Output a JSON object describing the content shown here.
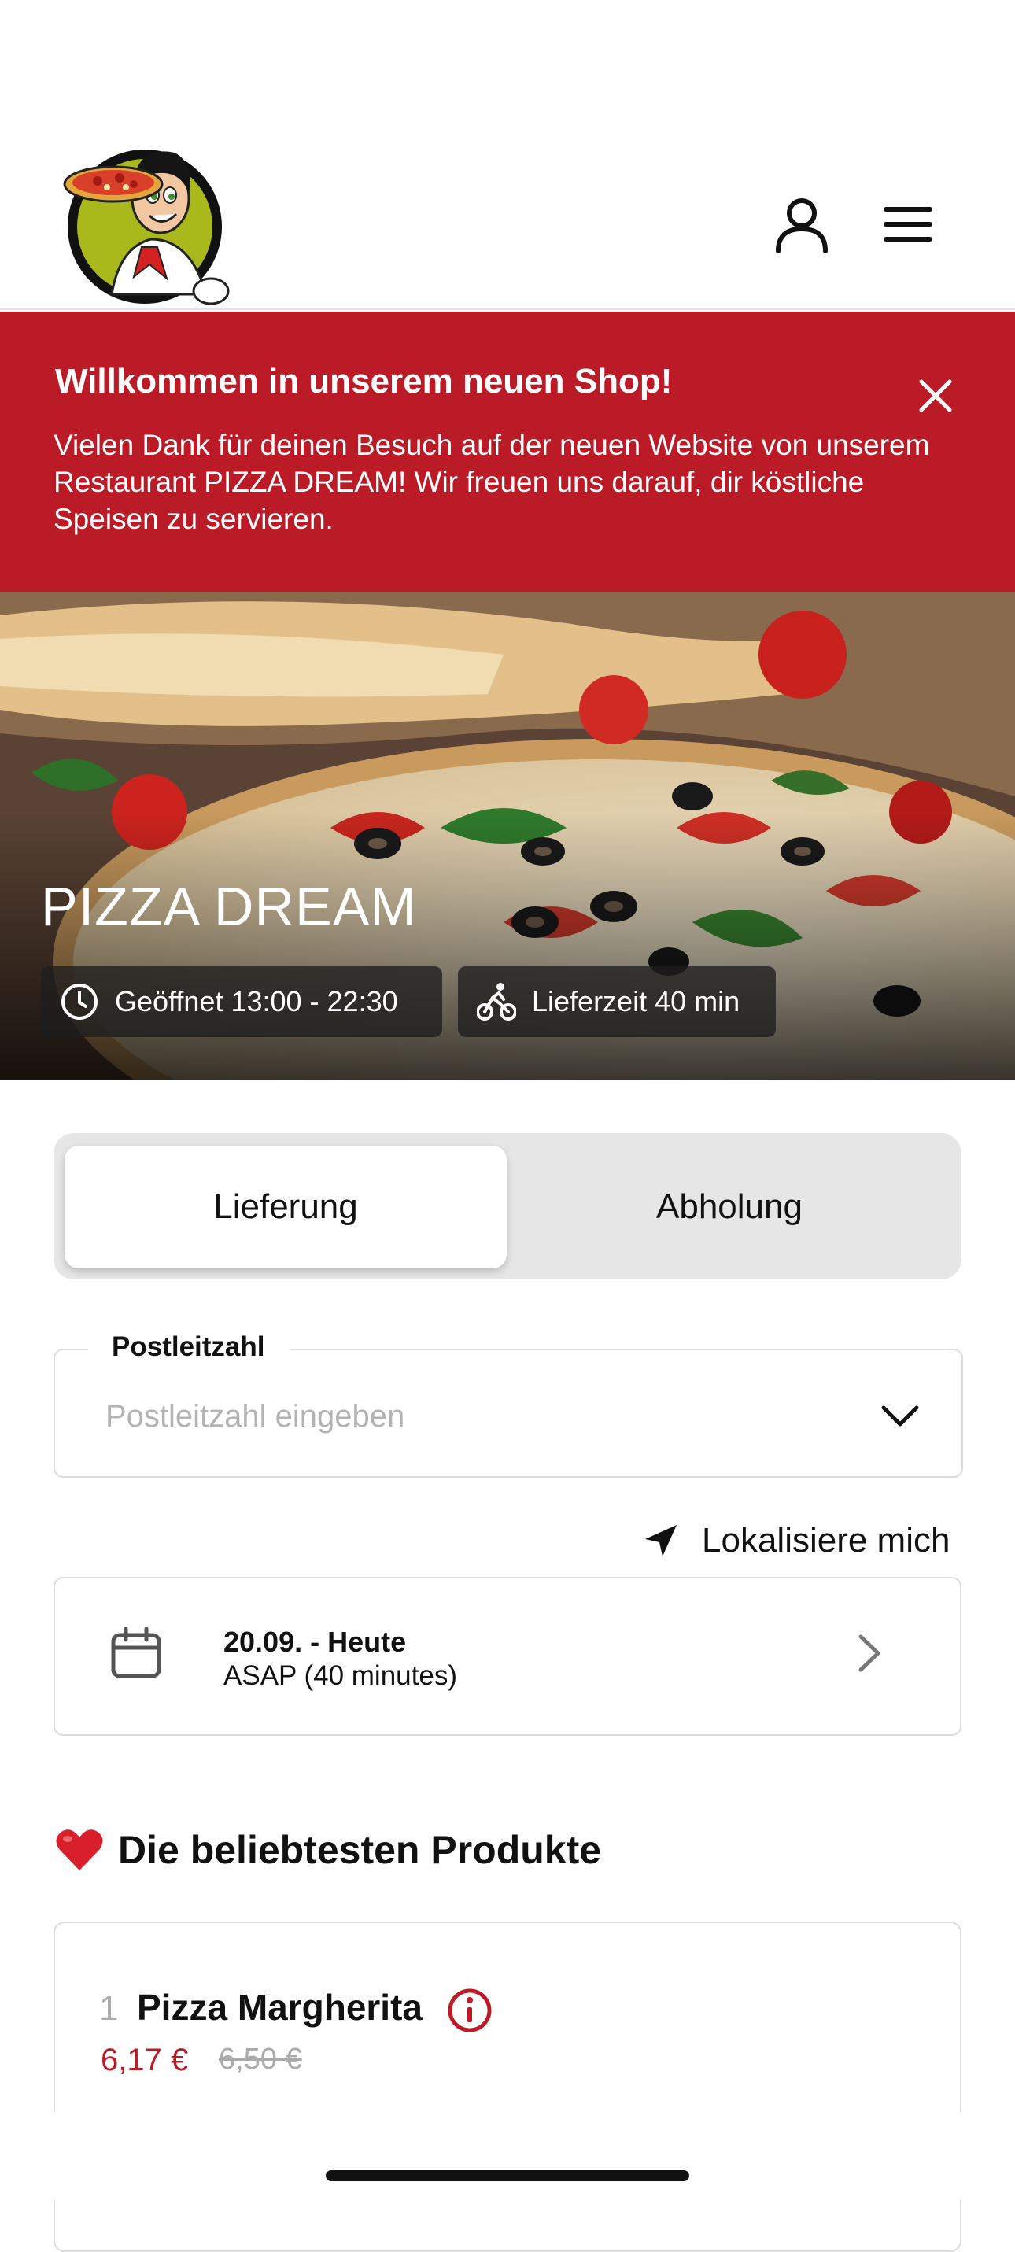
{
  "header": {
    "logo_icon": "pizza-chef-logo",
    "user_icon": "user-icon",
    "menu_icon": "hamburger-menu-icon"
  },
  "banner": {
    "title": "Willkommen in unserem neuen Shop!",
    "text": "Vielen Dank für deinen Besuch auf der neuen Website von unserem Restaurant PIZZA DREAM! Wir freuen uns darauf, dir köstliche Speisen zu servieren.",
    "close_icon": "close-icon",
    "background_color": "#bb1b27"
  },
  "hero": {
    "title": "PIZZA DREAM",
    "opening_hours": "Geöffnet 13:00 - 22:30",
    "delivery_time": "Lieferzeit 40 min",
    "clock_icon": "clock-icon",
    "bike_icon": "delivery-bike-icon"
  },
  "order_mode": {
    "options": [
      "Lieferung",
      "Abholung"
    ],
    "selected": "Lieferung"
  },
  "postal": {
    "label": "Postleitzahl",
    "placeholder": "Postleitzahl eingeben",
    "value": ""
  },
  "locate": {
    "label": "Lokalisiere mich",
    "icon": "location-arrow-icon"
  },
  "schedule": {
    "date": "20.09. - Heute",
    "time": "ASAP (40 minutes)",
    "icon": "calendar-icon"
  },
  "popular": {
    "heading": "Die beliebtesten Produkte",
    "emoji_icon": "heart-icon",
    "products": [
      {
        "rank": "1",
        "name": "Pizza Margherita",
        "price": "6,17 €",
        "old_price": "6,50 €"
      }
    ]
  },
  "colors": {
    "accent": "#bb1b27"
  }
}
